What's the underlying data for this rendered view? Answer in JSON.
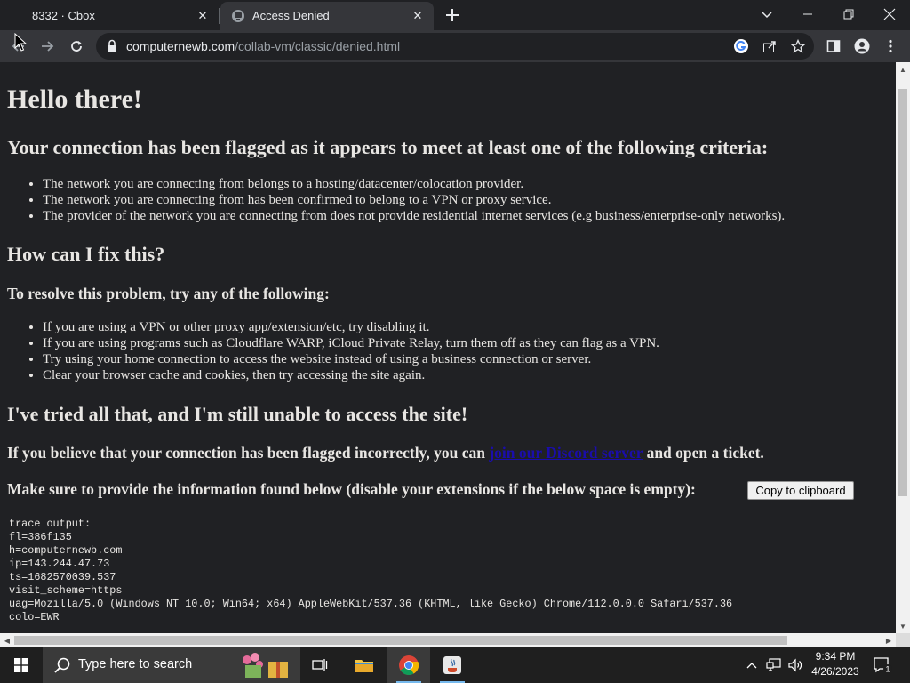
{
  "browser": {
    "tabs": [
      {
        "title": "8332 · Cbox",
        "active": false
      },
      {
        "title": "Access Denied",
        "active": true
      }
    ],
    "address": {
      "host": "computernewb.com",
      "path": "/collab-vm/classic/denied.html"
    }
  },
  "page": {
    "heading": "Hello there!",
    "flagged_heading": "Your connection has been flagged as it appears to meet at least one of the following criteria:",
    "criteria": [
      "The network you are connecting from belongs to a hosting/datacenter/colocation provider.",
      "The network you are connecting from has been confirmed to belong to a VPN or proxy service.",
      "The provider of the network you are connecting from does not provide residential internet services (e.g business/enterprise-only networks)."
    ],
    "fix_heading": "How can I fix this?",
    "resolve_heading": "To resolve this problem, try any of the following:",
    "fixes": [
      "If you are using a VPN or other proxy app/extension/etc, try disabling it.",
      "If you are using programs such as Cloudflare WARP, iCloud Private Relay, turn them off as they can flag as a VPN.",
      "Try using your home connection to access the website instead of using a business connection or server.",
      "Clear your browser cache and cookies, then try accessing the site again."
    ],
    "tried_heading": "I've tried all that, and I'm still unable to access the site!",
    "ticket_prefix": "If you believe that your connection has been flagged incorrectly, you can ",
    "ticket_link": "join our Discord server",
    "ticket_suffix": " and open a ticket.",
    "info_text": "Make sure to provide the information found below (disable your extensions if the below space is empty):",
    "copy_button": "Copy to clipboard",
    "trace_lines": [
      "trace output:",
      "",
      "fl=386f135",
      "h=computernewb.com",
      "ip=143.244.47.73",
      "ts=1682570039.537",
      "visit_scheme=https",
      "uag=Mozilla/5.0 (Windows NT 10.0; Win64; x64) AppleWebKit/537.36 (KHTML, like Gecko) Chrome/112.0.0.0 Safari/537.36",
      "colo=EWR"
    ]
  },
  "taskbar": {
    "search_placeholder": "Type here to search",
    "time": "9:34 PM",
    "date": "4/26/2023",
    "notification_count": "1"
  },
  "colors": {
    "page_background": "#202124",
    "link": "#1a0dab",
    "taskbar_accent": "#76b9ed"
  }
}
